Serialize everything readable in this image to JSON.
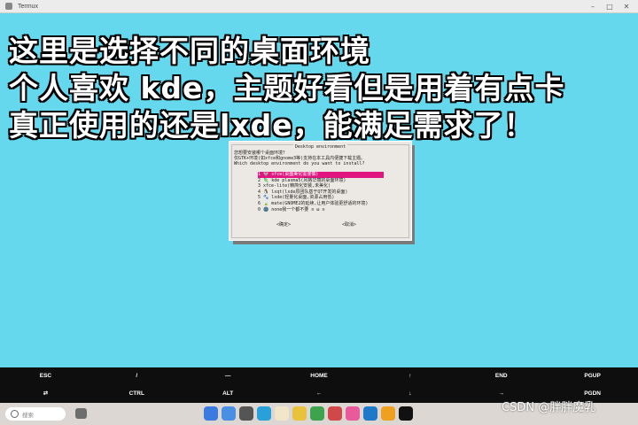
{
  "window": {
    "title": "Termux",
    "controls": [
      "–",
      "□",
      "✕"
    ]
  },
  "overlay": {
    "lines": [
      "这里是选择不同的桌面环境",
      "个人喜欢 kde，主题好看但是用着有点卡",
      "真正使用的还是lxde，能满足需求了！"
    ]
  },
  "dialog": {
    "title": "Desktop environment",
    "prompt": [
      "您想要安装哪个桌面环境？",
      "仅GTK+环境(如xfce和gnome3等)支持在本工具内便捷下载主题。",
      "Which desktop environment do you want to install?"
    ],
    "items": [
      "1 🐭 xfce(桌面美化需谨慎)",
      "2 🦎 kde plasma5(风格华丽的桌面环境)",
      "3 xfce-lite(精简化安装,未美化)",
      "4 🐧 lxqt(lxde原团队基于QT开发的桌面)",
      "5 🐾 lxde(轻量化桌面,资源占用低)",
      "6 🍃 mate(GNOME2的延续,让用户体验更舒适的环境)",
      "0 🌚 none我一个都不要 ≡ ω ≡"
    ],
    "selected_index": 0,
    "ok_label": "<确定>",
    "cancel_label": "<取消>"
  },
  "extra_keys": {
    "row1": [
      "ESC",
      "/",
      "—",
      "HOME",
      "↑",
      "END",
      "PGUP"
    ],
    "row2": [
      "⇄",
      "CTRL",
      "ALT",
      "←",
      "↓",
      "→",
      "PGDN"
    ]
  },
  "taskbar": {
    "search_placeholder": "搜索",
    "watermark": "CSDN @胖胖魔乳",
    "dock_icons": [
      "launcher-icon",
      "files-icon",
      "browser-icon",
      "store-icon",
      "notes-icon",
      "gallery-icon",
      "mail-icon",
      "media-icon",
      "send-icon",
      "terminal-alt-icon",
      "game-icon",
      "terminal-icon"
    ],
    "dock_colors": [
      "#3b7be0",
      "#4a90e2",
      "#555555",
      "#2aa0d8",
      "#f2e6c8",
      "#e8c23a",
      "#3fa34d",
      "#d04848",
      "#e85a9a",
      "#1f78c8",
      "#f0a020",
      "#111111"
    ]
  }
}
